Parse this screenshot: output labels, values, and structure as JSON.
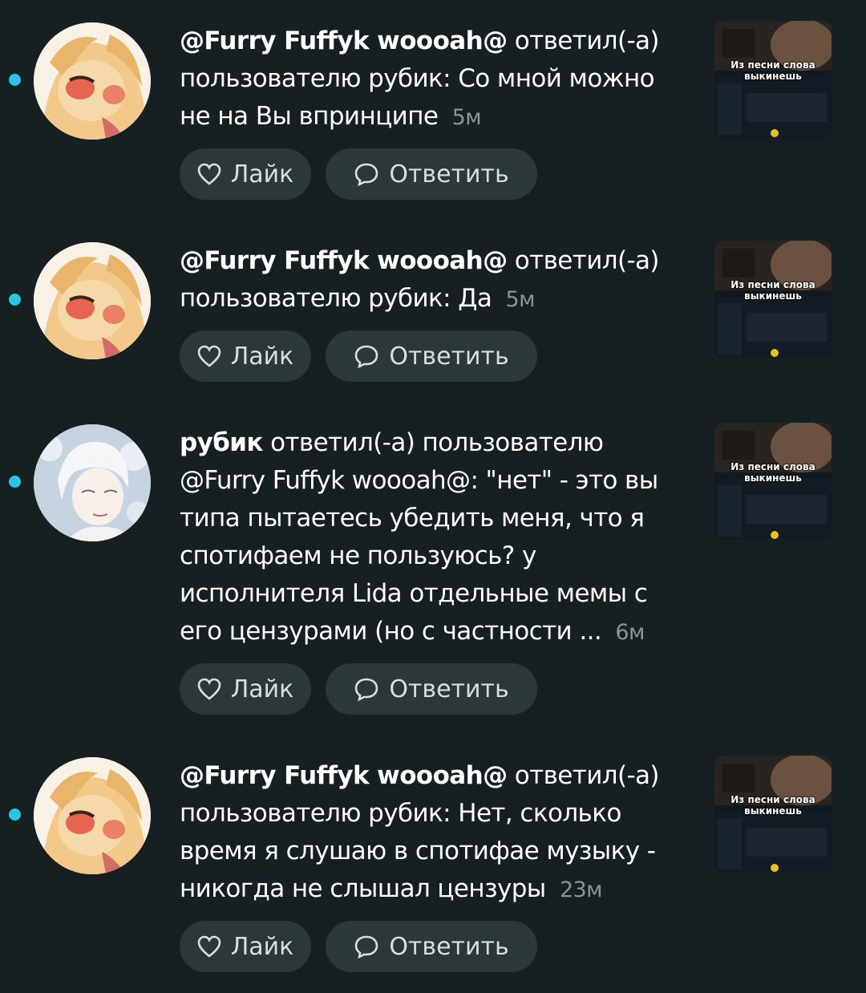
{
  "colors": {
    "accent_dot": "#29c5e6",
    "background": "#161f21",
    "button_bg": "#2c3739"
  },
  "notifications": [
    {
      "name": "@Furry Fuffyk woooah@",
      "text": "ответил(-а) пользователю рубик: Со мной можно не на Вы впринципе",
      "time": "5м",
      "avatar": "furry",
      "like_label": "Лайк",
      "reply_label": "Ответить",
      "thumb_caption": "Из песни слова выкинешь"
    },
    {
      "name": "@Furry Fuffyk woooah@",
      "text": "ответил(-а) пользователю рубик: Да",
      "time": "5м",
      "avatar": "furry",
      "like_label": "Лайк",
      "reply_label": "Ответить",
      "thumb_caption": "Из песни слова выкинешь"
    },
    {
      "name": "рубик",
      "text": "ответил(-а) пользователю @Furry Fuffyk woooah@: \"нет\" - это вы типа пытаетесь убедить меня, что я спотифаем не пользуюсь? у исполнителя Lida отдельные мемы с его цензурами (но с частности ...",
      "time": "6м",
      "avatar": "rubik",
      "like_label": "Лайк",
      "reply_label": "Ответить",
      "thumb_caption": "Из песни слова выкинешь"
    },
    {
      "name": "@Furry Fuffyk woooah@",
      "text": "ответил(-а) пользователю рубик: Нет, сколько время я слушаю в спотифае музыку - никогда не слышал цензуры",
      "time": "23м",
      "avatar": "furry",
      "like_label": "Лайк",
      "reply_label": "Ответить",
      "thumb_caption": "Из песни слова выкинешь"
    }
  ]
}
